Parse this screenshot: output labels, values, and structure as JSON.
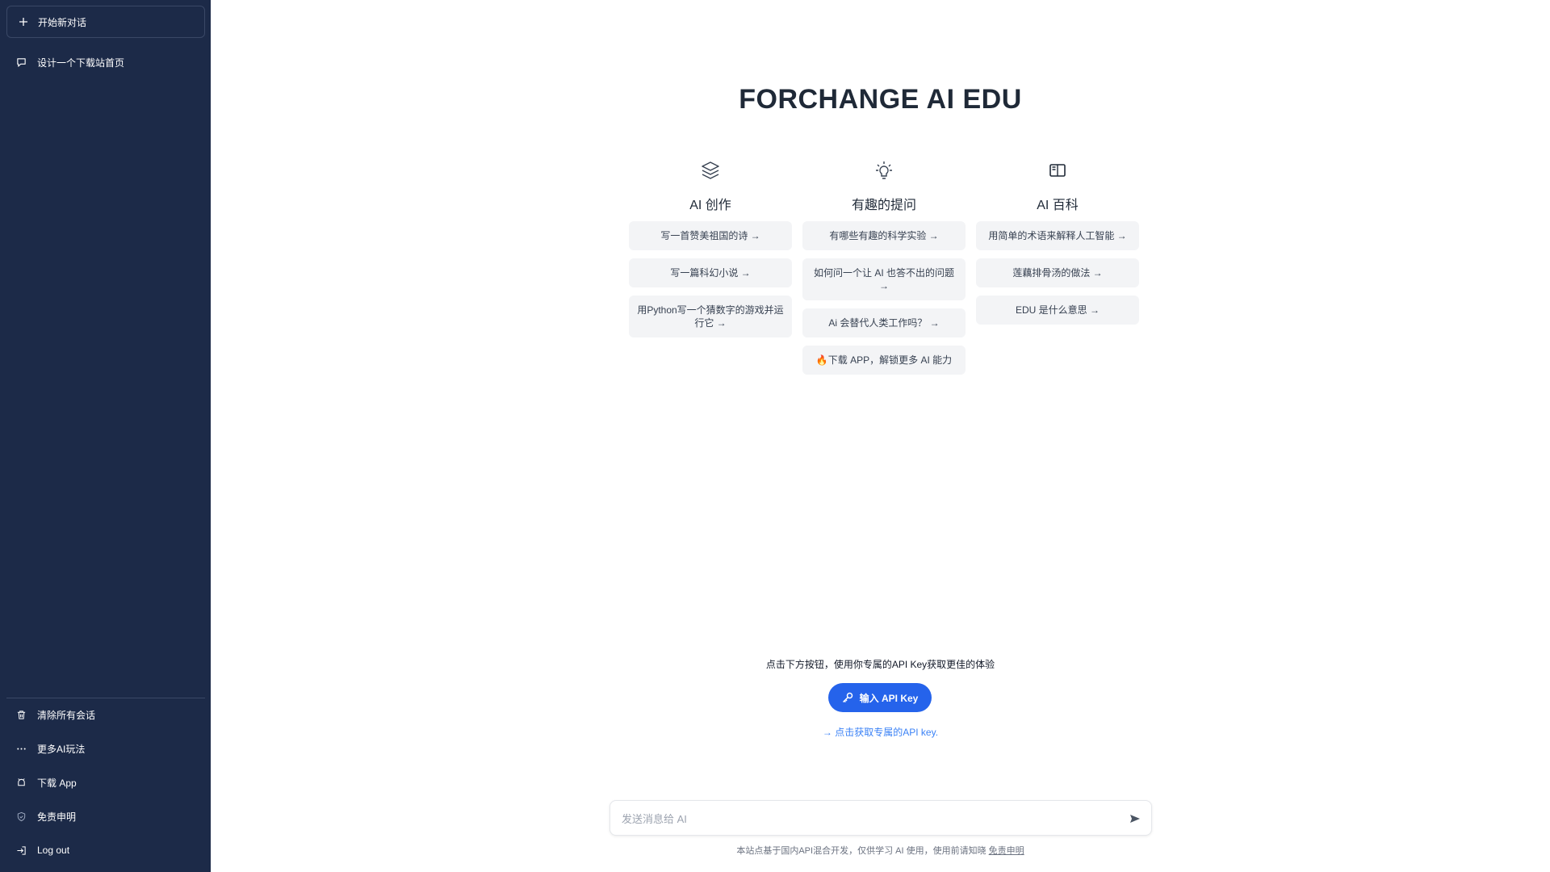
{
  "sidebar": {
    "new_chat": "开始新对话",
    "history": [
      {
        "label": "设计一个下载站首页"
      }
    ],
    "bottom": {
      "clear": "清除所有会话",
      "more": "更多AI玩法",
      "download": "下载 App",
      "disclaimer": "免责申明",
      "logout": "Log out"
    }
  },
  "main": {
    "title": "FORCHANGE AI EDU",
    "columns": [
      {
        "icon": "layers-icon",
        "title": "AI 创作",
        "cards": [
          "写一首赞美祖国的诗 →",
          "写一篇科幻小说 →",
          "用Python写一个猜数字的游戏并运行它 →"
        ]
      },
      {
        "icon": "lightbulb-icon",
        "title": "有趣的提问",
        "cards": [
          "有哪些有趣的科学实验 →",
          "如何问一个让 AI 也答不出的问题 →",
          "Ai 会替代人类工作吗？ →",
          "🔥下载 APP，解锁更多 AI 能力"
        ]
      },
      {
        "icon": "book-icon",
        "title": "AI 百科",
        "cards": [
          "用简单的术语来解释人工智能 →",
          "莲藕排骨汤的做法 →",
          "EDU 是什么意思 →"
        ]
      }
    ],
    "hint": "点击下方按钮，使用你专属的API Key获取更佳的体验",
    "api_button": "输入 API Key",
    "api_link": "→ 点击获取专属的API key.",
    "input_placeholder": "发送消息给 AI",
    "footer_text": "本站点基于国内API混合开发，仅供学习 AI 使用，使用前请知晓",
    "footer_link": "免责申明"
  },
  "colors": {
    "sidebar_bg": "#1c2a48",
    "accent": "#2563eb",
    "card_bg": "#f3f4f6"
  }
}
